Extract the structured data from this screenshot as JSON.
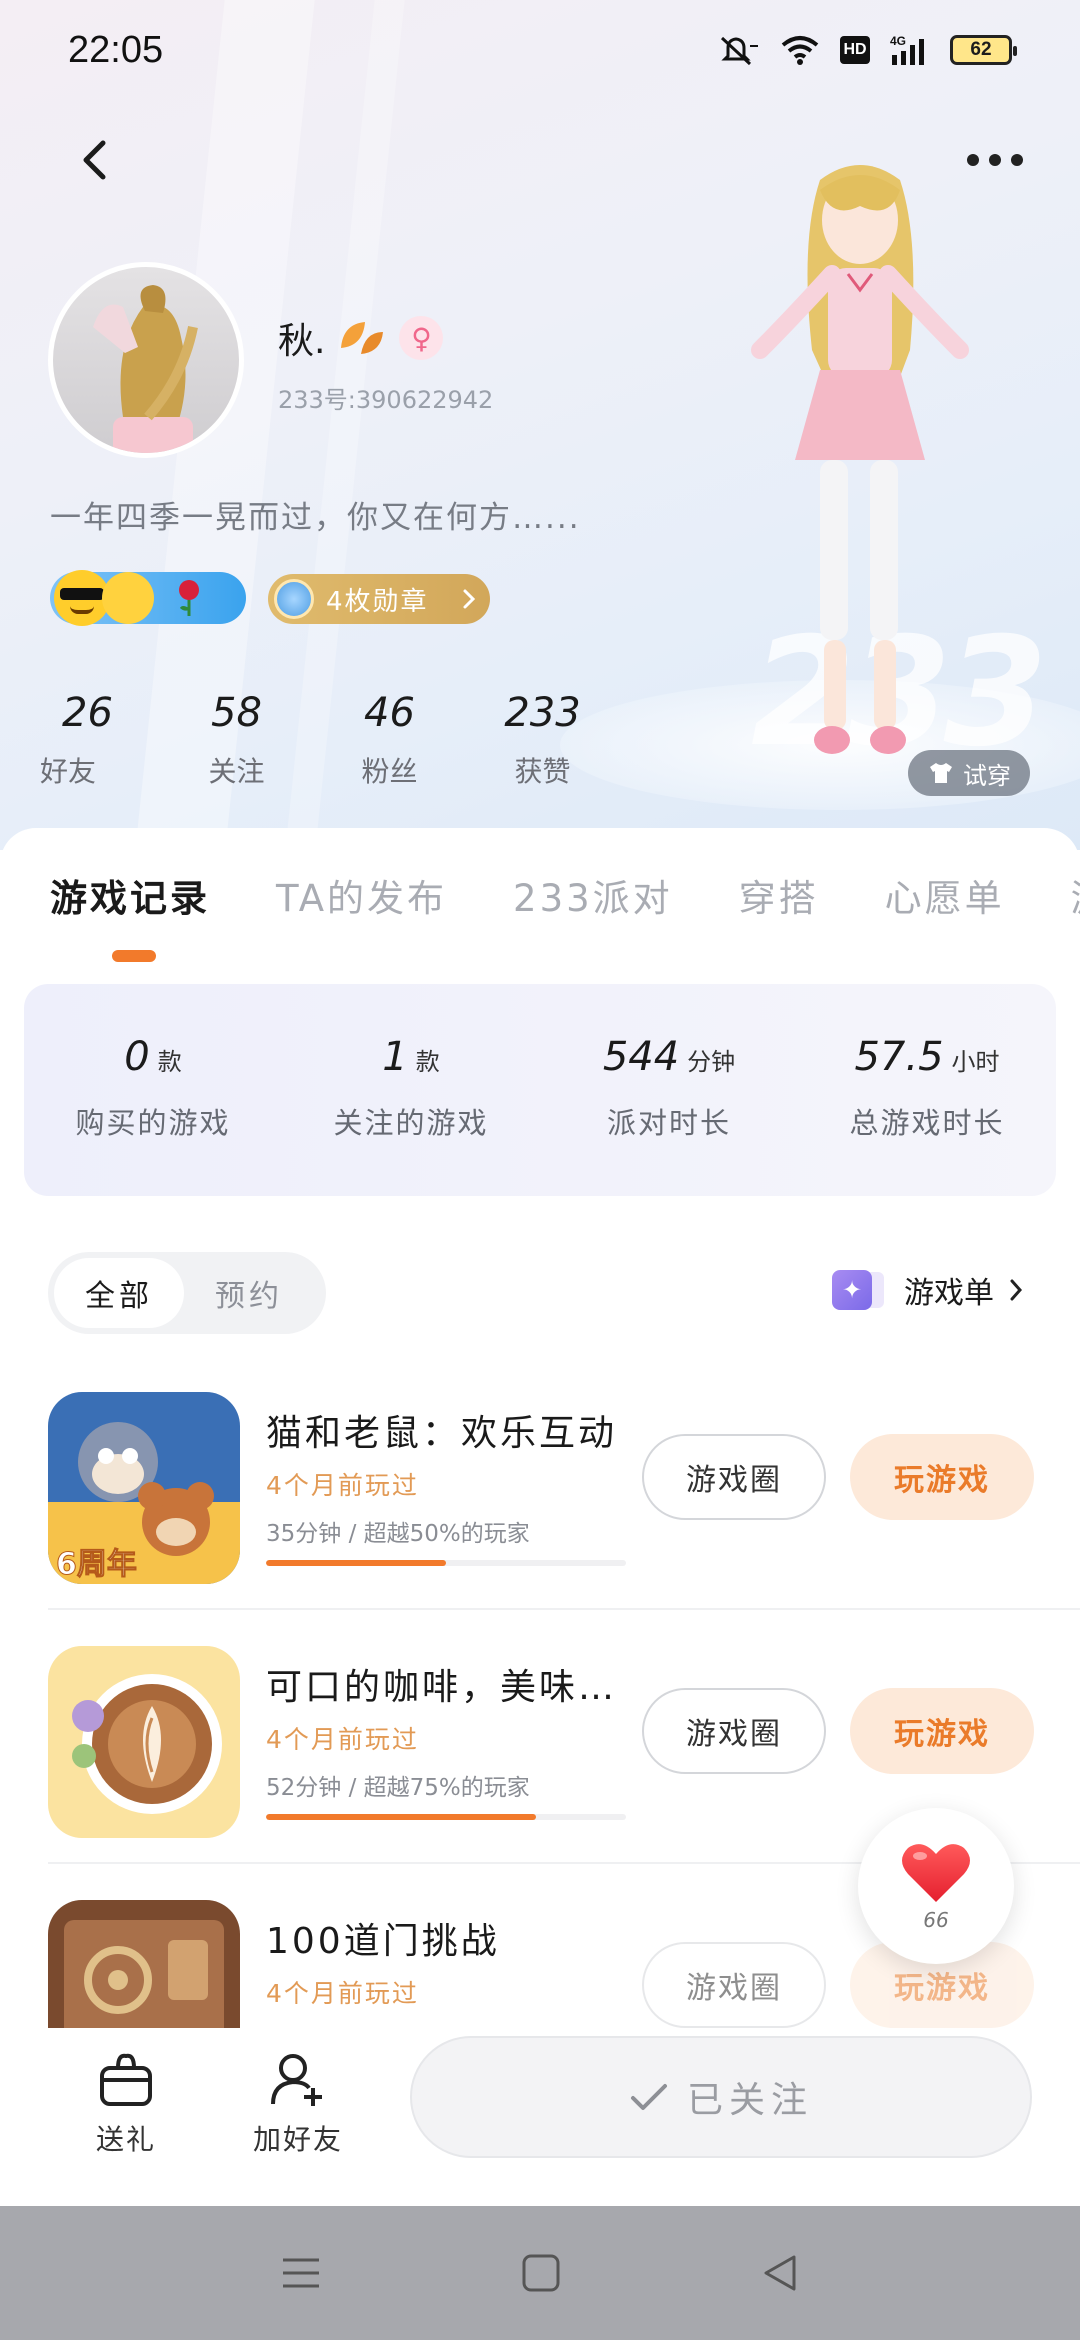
{
  "status_bar": {
    "time": "22:05",
    "hd": "HD",
    "network": "4G",
    "battery": "62"
  },
  "profile": {
    "username": "秋.",
    "uid": "233号:390622942",
    "bio": "一年四季一晃而过，你又在何方…...",
    "gender_symbol": "♀",
    "medal_text": "4枚勋章",
    "stats": [
      {
        "value": "26",
        "label": "好友"
      },
      {
        "value": "58",
        "label": "关注"
      },
      {
        "value": "46",
        "label": "粉丝"
      },
      {
        "value": "233",
        "label": "获赞"
      }
    ],
    "try_on": "试穿",
    "watermark": "233"
  },
  "tabs": [
    {
      "label": "游戏记录",
      "active": true
    },
    {
      "label": "TA的发布",
      "active": false
    },
    {
      "label": "233派对",
      "active": false
    },
    {
      "label": "穿搭",
      "active": false
    },
    {
      "label": "心愿单",
      "active": false
    },
    {
      "label": "游",
      "active": false
    }
  ],
  "summary": [
    {
      "value": "0",
      "unit": "款",
      "label": "购买的游戏"
    },
    {
      "value": "1",
      "unit": "款",
      "label": "关注的游戏"
    },
    {
      "value": "544",
      "unit": "分钟",
      "label": "派对时长"
    },
    {
      "value": "57.5",
      "unit": "小时",
      "label": "总游戏时长"
    }
  ],
  "filter": {
    "options": [
      "全部",
      "预约"
    ],
    "selected": "全部",
    "gamelist_label": "游戏单"
  },
  "games": [
    {
      "title": "猫和老鼠：欢乐互动",
      "played": "4个月前玩过",
      "stats": "35分钟 / 超越50%的玩家",
      "progress": 0.5,
      "icon_label": "6周年"
    },
    {
      "title": "可口的咖啡，美味…",
      "played": "4个月前玩过",
      "stats": "52分钟 / 超越75%的玩家",
      "progress": 0.75,
      "icon_label": ""
    },
    {
      "title": "100道门挑战",
      "played": "4个月前玩过",
      "stats": "",
      "progress": 0,
      "icon_label": ""
    }
  ],
  "game_buttons": {
    "circle": "游戏圈",
    "play": "玩游戏"
  },
  "likes": {
    "count": "66"
  },
  "action_bar": {
    "gift": "送礼",
    "add_friend": "加好友",
    "followed": "已关注"
  },
  "colors": {
    "accent": "#f27a2b",
    "played_text": "#e29a55",
    "medal_gold": "#d8ad60",
    "gender_pink": "#f0678b"
  }
}
